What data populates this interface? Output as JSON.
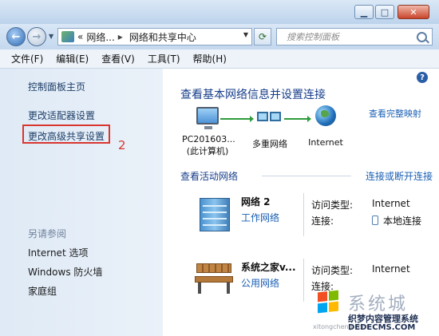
{
  "addressbar": {
    "prefix": "«",
    "crumbs": [
      "网络...",
      "网络和共享中心"
    ],
    "separator": "▸",
    "search_placeholder": "搜索控制面板"
  },
  "menubar": [
    "文件(F)",
    "编辑(E)",
    "查看(V)",
    "工具(T)",
    "帮助(H)"
  ],
  "sidebar": {
    "home": "控制面板主页",
    "adapter": "更改适配器设置",
    "advanced_sharing": "更改高级共享设置",
    "step_number": "2",
    "see_also": "另请参阅",
    "internet_options": "Internet 选项",
    "firewall": "Windows 防火墙",
    "homegroup": "家庭组"
  },
  "main": {
    "help": "?",
    "heading": "查看基本网络信息并设置连接",
    "full_map": "查看完整映射",
    "map": {
      "pc_name": "PC201603...",
      "pc_sub": "(此计算机)",
      "multi": "多重网络",
      "internet": "Internet"
    },
    "active_networks": "查看活动网络",
    "connect_disconnect": "连接或断开连接",
    "networks": [
      {
        "name": "网络  2",
        "type": "工作网络",
        "access_label": "访问类型:",
        "access_value": "Internet",
        "conn_label": "连接:",
        "conn_value": "本地连接"
      },
      {
        "name": "系统之家v...",
        "type": "公用网络",
        "access_label": "访问类型:",
        "access_value": "Internet",
        "conn_label": "连接:",
        "conn_value": ""
      }
    ]
  },
  "watermark": {
    "title": "系统城",
    "sub": "织梦内容管理系统",
    "url": "DEDECMS.COM",
    "small": "xitongcheng.com"
  }
}
